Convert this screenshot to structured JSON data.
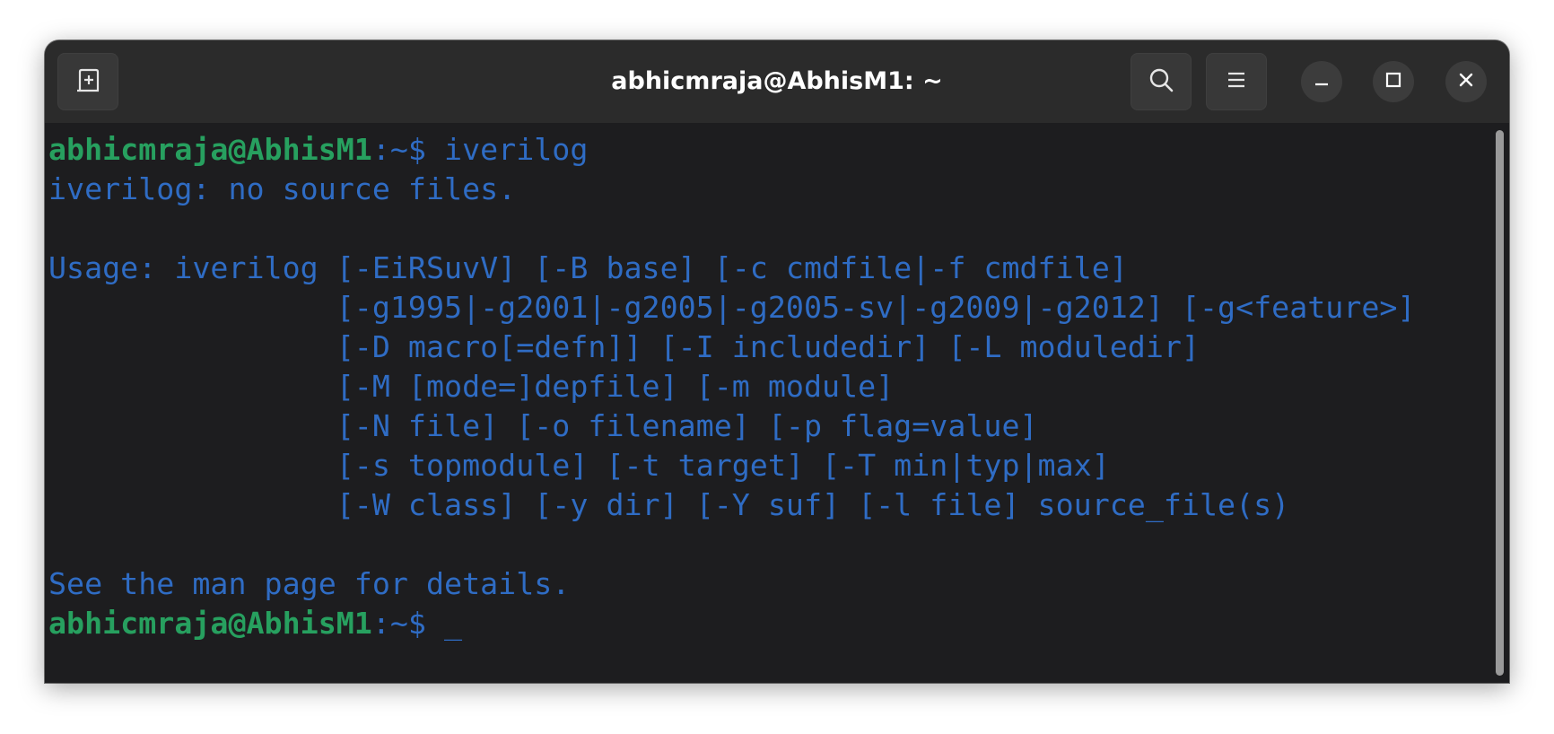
{
  "window": {
    "title": "abhicmraja@AbhisM1: ~"
  },
  "header": {
    "new_tab_icon": "new-tab-icon",
    "search_icon": "search-icon",
    "menu_icon": "hamburger-menu-icon",
    "minimize_icon": "minimize-icon",
    "maximize_icon": "maximize-icon",
    "close_icon": "close-icon"
  },
  "colors": {
    "prompt_user": "#27a05f",
    "output_text": "#2f6cc4",
    "background": "#1d1d1f",
    "titlebar": "#2b2b2b"
  },
  "terminal": {
    "prompt_user": "abhicmraja@AbhisM1",
    "prompt_suffix": ":~$ ",
    "command": "iverilog",
    "lines": [
      "iverilog: no source files.",
      "",
      "Usage: iverilog [-EiRSuvV] [-B base] [-c cmdfile|-f cmdfile]",
      "                [-g1995|-g2001|-g2005|-g2005-sv|-g2009|-g2012] [-g<feature>]",
      "                [-D macro[=defn]] [-I includedir] [-L moduledir]",
      "                [-M [mode=]depfile] [-m module]",
      "                [-N file] [-o filename] [-p flag=value]",
      "                [-s topmodule] [-t target] [-T min|typ|max]",
      "                [-W class] [-y dir] [-Y suf] [-l file] source_file(s)",
      "",
      "See the man page for details."
    ],
    "cursor": "_"
  }
}
